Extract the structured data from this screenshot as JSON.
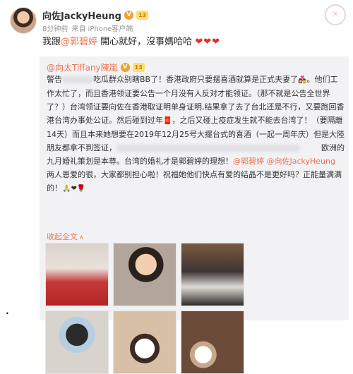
{
  "post": {
    "author": "向佐JackyHeung",
    "verified_badge": "V",
    "level_badge": "13",
    "time": "8分钟前",
    "source": "来自 iPhone客户端",
    "text_prefix": "我跟",
    "mention": "@郭碧婷",
    "text_suffix": " 開心就好，沒事媽哈哈",
    "hearts": "❤❤❤"
  },
  "repost": {
    "author": "@向太Tiffany陳嵐",
    "verified_badge": "V",
    "level_badge": "13",
    "line1_start": "警告",
    "line1_end": "吃瓜群众别瞎BB了！香港政府只要摆喜酒就算是正式夫妻了",
    "emoji1": "👩‍❤️‍👨",
    "line1_tail": "。他们工作太忙了，而且香港领证要公告一个月没有人反对才能领证。（那不就是公告全世界了？）台湾领证要向佐在香港取证明单身证明,结果拿了去了台北还是不行，又要跑回香港台湾办事处公证。然后碰到过年",
    "emoji2": "🧧",
    "line1_tail2": "，之后又碰上疫症发生就不能去台湾了！（要隔離14天）而且本来她想要在2019年12月25号大擺台式的喜酒（一起一周年庆）但是大陸朋友都拿不到签证，",
    "right_bit": "欧洲的",
    "line2": "九月婚礼策划是本尊。台湾的婚礼才是郭碧婷的理想！",
    "mention1": "@郭碧婷",
    "mention2": "@向佐JackyHeung",
    "line3": " 两人恩爱的很，大家都别担心啦！祝福她他们快点有爱的结晶不是更好吗？正能量满满的！",
    "end_emojis": "🙏❤🌹",
    "collapse_label": "收起全文",
    "collapse_arrow": "∧"
  },
  "stamp": "✕",
  "bullet": "•"
}
